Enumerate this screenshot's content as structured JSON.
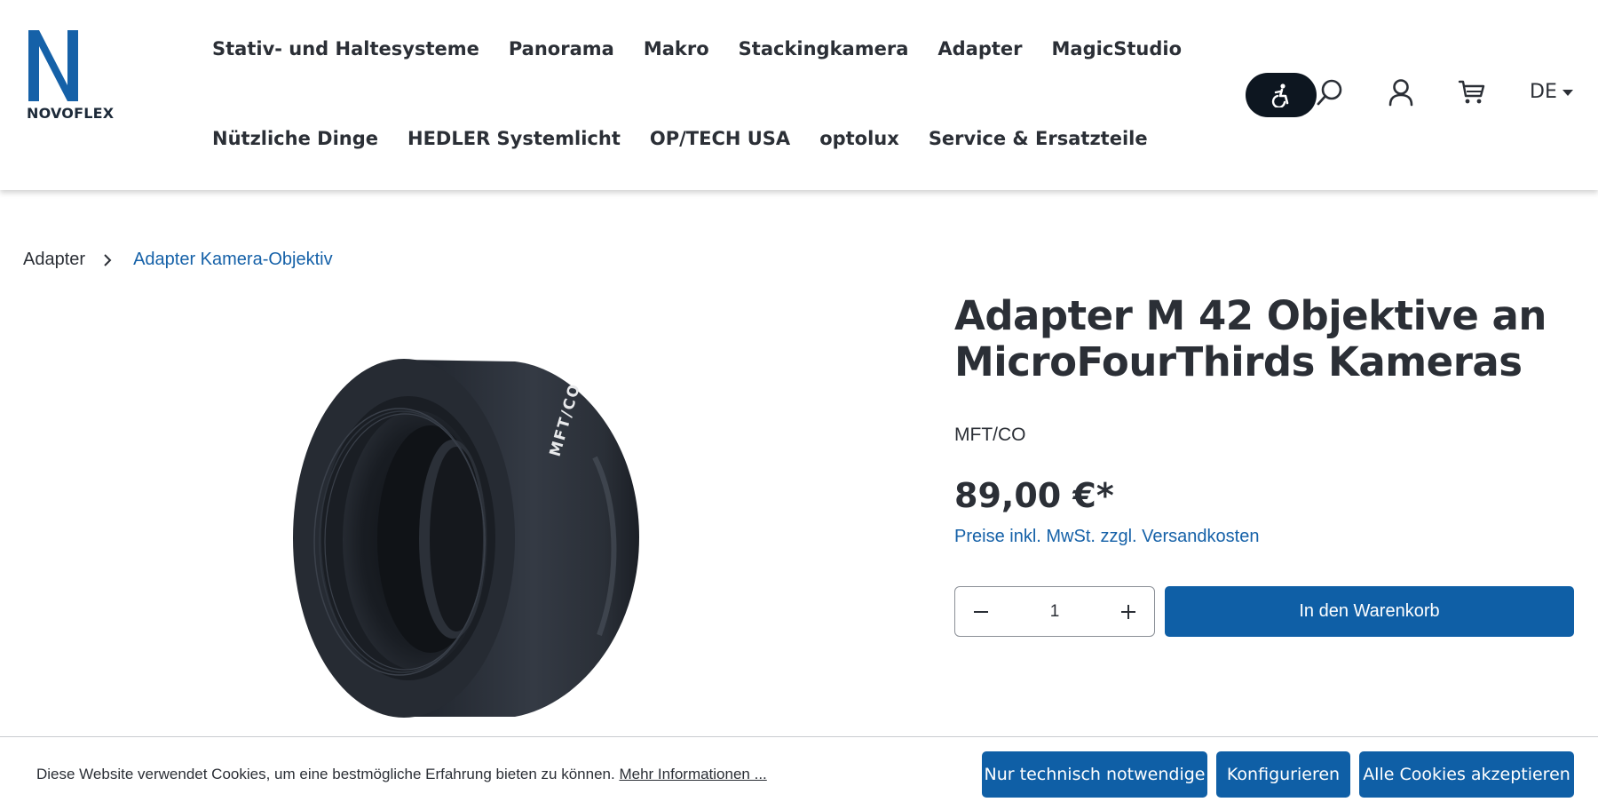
{
  "brand": {
    "logo_letter": "N",
    "logo_text": "NOVOFLEX",
    "accent_color": "#0f5fa6",
    "logo_color": "#1561a8"
  },
  "nav": {
    "row1": [
      "Stativ- und Haltesysteme",
      "Panorama",
      "Makro",
      "Stackingkamera",
      "Adapter",
      "MagicStudio"
    ],
    "row2": [
      "Nützliche Dinge",
      "HEDLER Systemlicht",
      "OP/TECH USA",
      "optolux",
      "Service & Ersatzteile"
    ]
  },
  "header_icons": [
    "accessibility-icon",
    "search-icon",
    "user-icon",
    "cart-icon"
  ],
  "language": {
    "selected": "DE"
  },
  "breadcrumb": {
    "items": [
      "Adapter",
      "Adapter Kamera-Objektiv"
    ]
  },
  "product": {
    "title": "Adapter M 42 Objektive an MicroFourThirds Kameras",
    "sku": "MFT/CO",
    "price": "89,00 €*",
    "price_note": "Preise inkl. MwSt. zzgl. Versandkosten",
    "image_engraving": "MFT/CO",
    "quantity": "1",
    "add_to_cart_label": "In den Warenkorb"
  },
  "cookie": {
    "text": "Diese Website verwendet Cookies, um eine bestmögliche Erfahrung bieten zu können.",
    "link": "Mehr Informationen ...",
    "buttons": [
      "Nur technisch notwendige",
      "Konfigurieren",
      "Alle Cookies akzeptieren"
    ]
  }
}
